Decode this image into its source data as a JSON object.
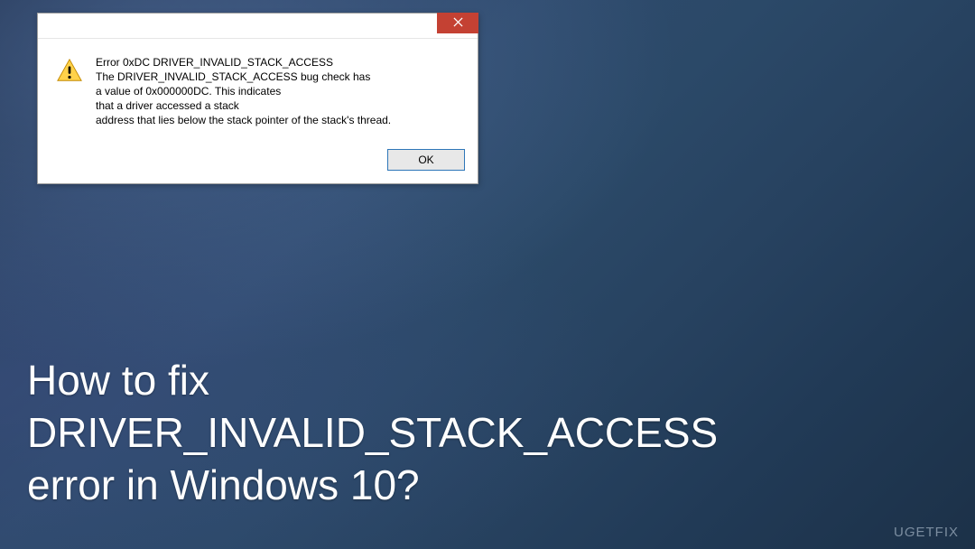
{
  "dialog": {
    "close_name": "close",
    "warning_name": "warning",
    "lines": {
      "l1": "Error 0xDC DRIVER_INVALID_STACK_ACCESS",
      "l2": "The DRIVER_INVALID_STACK_ACCESS bug check has",
      "l3": "a value of 0x000000DC. This indicates",
      "l4": "that a driver accessed a stack",
      "l5": "address that lies below the stack pointer of the stack's thread."
    },
    "ok_label": "OK"
  },
  "headline": {
    "l1": "How to fix",
    "l2": "DRIVER_INVALID_STACK_ACCESS",
    "l3": "error in Windows 10?"
  },
  "watermark": {
    "pre": "U",
    "g": "G",
    "post": "ETFIX"
  }
}
